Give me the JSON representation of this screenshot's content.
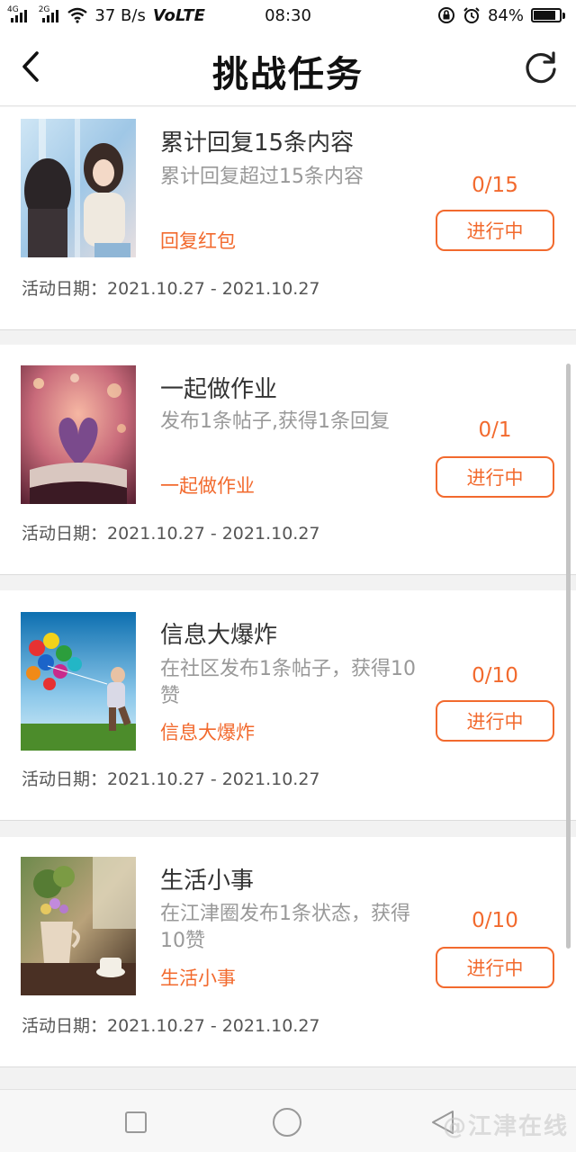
{
  "status_bar": {
    "network_left": "4G",
    "network_right": "2G",
    "speed": "37 B/s",
    "volte": "VoLTE",
    "time": "08:30",
    "battery": "84%",
    "battery_level": 0.84
  },
  "header": {
    "title": "挑战任务",
    "back_icon": "chevron-left-icon",
    "refresh_icon": "refresh-icon"
  },
  "tasks": [
    {
      "title": "累计回复15条内容",
      "desc": "累计回复超过15条内容",
      "tag": "回复红包",
      "progress": "0/15",
      "status": "进行中",
      "date": "活动日期：2021.10.27 - 2021.10.27"
    },
    {
      "title": "一起做作业",
      "desc": "发布1条帖子,获得1条回复",
      "tag": "一起做作业",
      "progress": "0/1",
      "status": "进行中",
      "date": "活动日期：2021.10.27 - 2021.10.27"
    },
    {
      "title": "信息大爆炸",
      "desc": "在社区发布1条帖子，获得10赞",
      "tag": "信息大爆炸",
      "progress": "0/10",
      "status": "进行中",
      "date": "活动日期：2021.10.27 - 2021.10.27"
    },
    {
      "title": "生活小事",
      "desc": "在江津圈发布1条状态，获得10赞",
      "tag": "生活小事",
      "progress": "0/10",
      "status": "进行中",
      "date": "活动日期：2021.10.27 - 2021.10.27"
    }
  ],
  "nav_bar": {
    "watermark": "@江津在线"
  },
  "colors": {
    "accent": "#f26a2e",
    "background": "#f2f2f2"
  }
}
